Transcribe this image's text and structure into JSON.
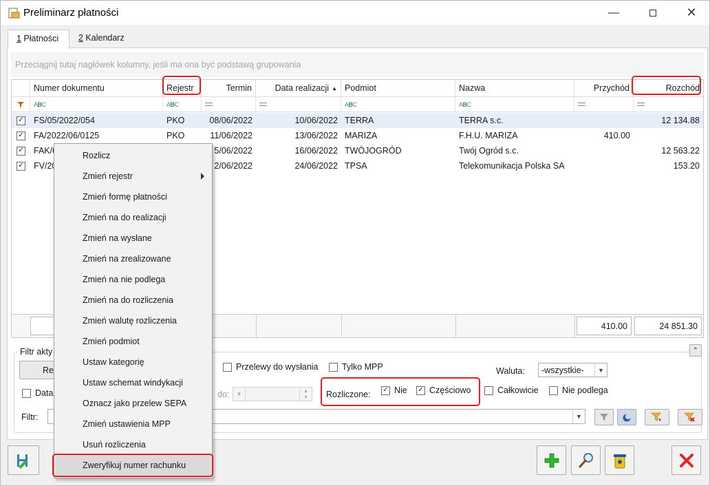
{
  "window": {
    "title": "Preliminarz płatności",
    "minimize_icon": "minimize-icon",
    "maximize_icon": "maximize-icon",
    "close_icon": "close-icon"
  },
  "tabs": [
    {
      "key": "1",
      "label": " Płatności",
      "active": true
    },
    {
      "key": "2",
      "label": " Kalendarz",
      "active": false
    }
  ],
  "grid": {
    "group_hint": "Przeciągnij tutaj nagłówek kolumny, jeśli ma ona być podstawą grupowania",
    "columns": [
      "Numer dokumentu",
      "Rejestr",
      "Termin",
      "Data realizacji",
      "Podmiot",
      "Nazwa",
      "Przychód",
      "Rozchód"
    ],
    "sort_indicator": "▲",
    "rows": [
      {
        "checked": true,
        "numer": "FS/05/2022/054",
        "rejestr": "PKO",
        "termin": "08/06/2022",
        "data_realizacji": "10/06/2022",
        "podmiot": "TERRA",
        "nazwa": "TERRA s.c.",
        "przychod": "",
        "rozchod": "12 134.88"
      },
      {
        "checked": true,
        "numer": "FA/2022/06/0125",
        "rejestr": "PKO",
        "termin": "11/06/2022",
        "data_realizacji": "13/06/2022",
        "podmiot": "MARIZA",
        "nazwa": "F.H.U. MARIZA",
        "przychod": "410.00",
        "rozchod": ""
      },
      {
        "checked": true,
        "numer": "FAK/0",
        "rejestr": "",
        "termin": "5/06/2022",
        "data_realizacji": "16/06/2022",
        "podmiot": "TWÓJOGRÓD",
        "nazwa": "Twój Ogród s.c.",
        "przychod": "",
        "rozchod": "12 563.22"
      },
      {
        "checked": true,
        "numer": "FV/20",
        "rejestr": "",
        "termin": "2/06/2022",
        "data_realizacji": "24/06/2022",
        "podmiot": "TPSA",
        "nazwa": "Telekomunikacja Polska SA",
        "przychod": "",
        "rozchod": "153.20"
      }
    ],
    "totals": {
      "przychod": "410.00",
      "rozchod": "24 851.30"
    }
  },
  "context_menu": {
    "items": [
      "Rozlicz",
      "Zmień rejestr",
      "Zmień formę płatności",
      "Zmień na do realizacji",
      "Zmień na wysłane",
      "Zmień na zrealizowane",
      "Zmień na nie podlega",
      "Zmień na do rozliczenia",
      "Zmień walutę rozliczenia",
      "Zmień podmiot",
      "Ustaw kategorię",
      "Ustaw schemat windykacji",
      "Oznacz jako przelew SEPA",
      "Zmień ustawienia MPP",
      "Usuń rozliczenia",
      "Zweryfikuj numer rachunku"
    ],
    "highlighted_index": 15
  },
  "filters": {
    "legend": "Filtr akty",
    "rej_button": "Rej",
    "przelewy_label": "Przelewy do wysłania",
    "tylko_mpp_label": "Tylko MPP",
    "waluta_label": "Waluta:",
    "waluta_value": "-wszystkie-",
    "data_label": "Data",
    "do_label": "do:",
    "rozliczone_label": "Rozliczone:",
    "nie_label": "Nie",
    "nie_checked": true,
    "czesciowo_label": "Częściowo",
    "czesciowo_checked": true,
    "calkowicie_label": "Całkowicie",
    "nie_podlega_label": "Nie podlega",
    "filtr_label": "Filtr:",
    "filtr_value": ""
  },
  "colors": {
    "highlight_red": "#e02020",
    "selected_row": "#e8eef9",
    "add_green": "#2fb52f",
    "cancel_red": "#e02828"
  }
}
